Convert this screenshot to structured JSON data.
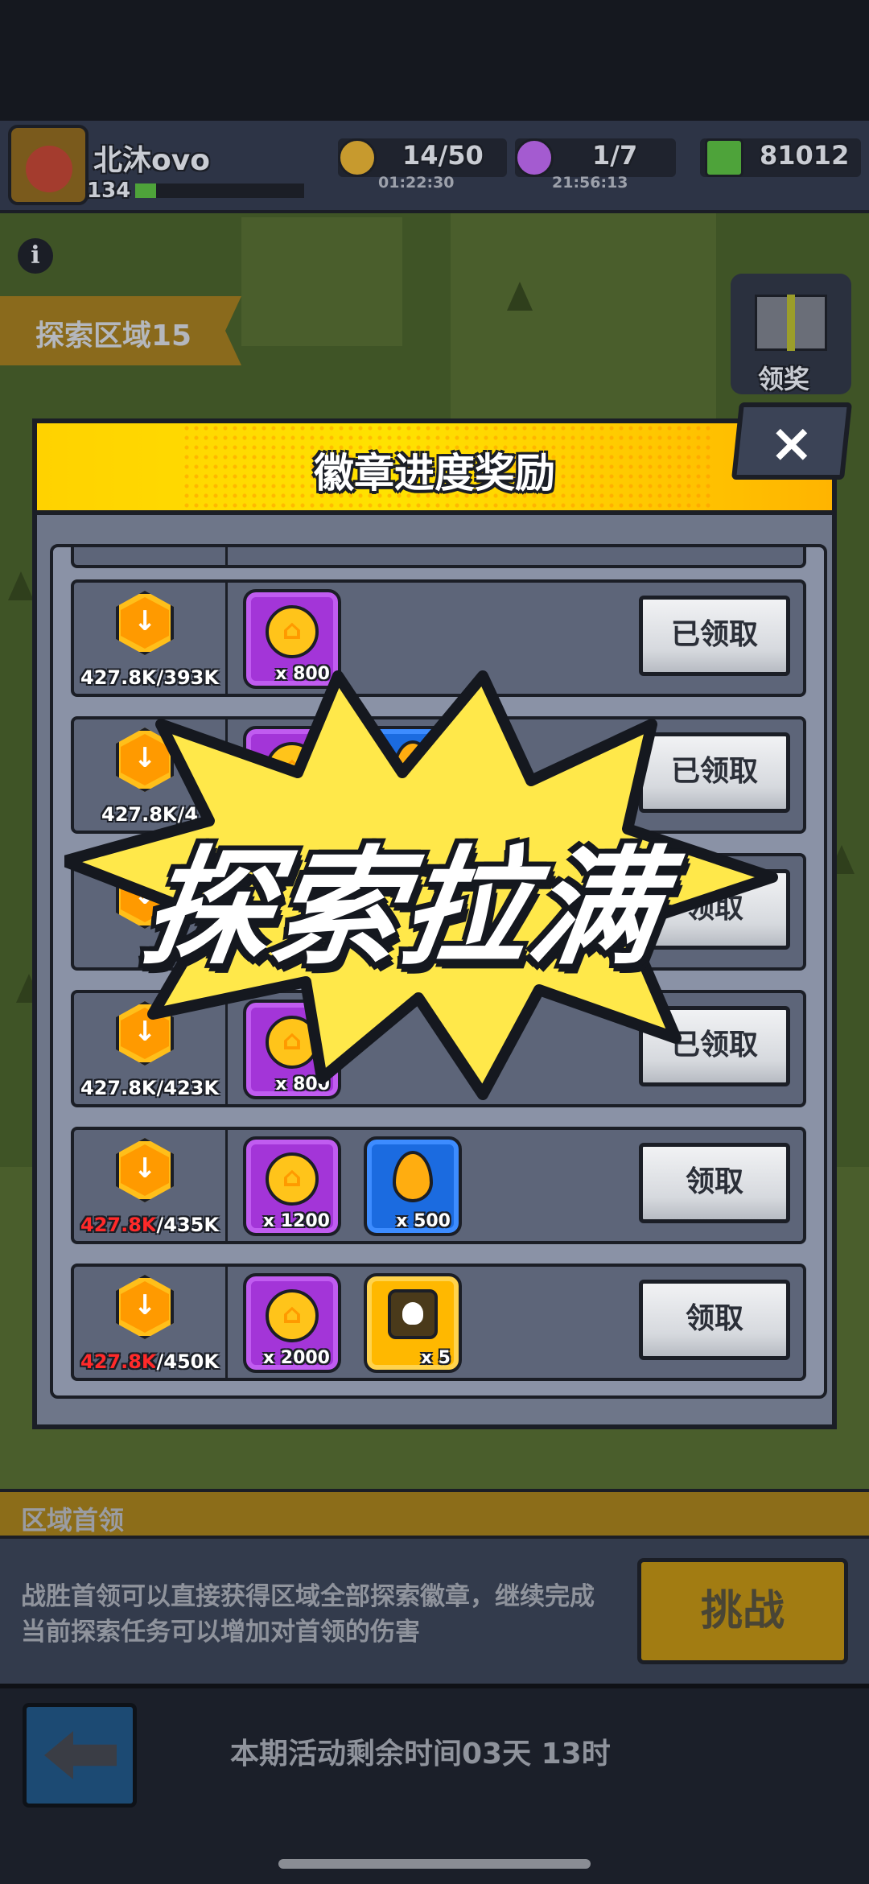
{
  "player": {
    "name": "北沐ovo",
    "level": "134"
  },
  "resources": [
    {
      "name": "energy",
      "value": "14/50",
      "timer": "01:22:30",
      "color": "#c79a2e"
    },
    {
      "name": "potion",
      "value": "1/7",
      "timer": "21:56:13",
      "color": "#a45bd0"
    },
    {
      "name": "gems",
      "value": "81012",
      "color": "#4ea33a"
    }
  ],
  "area": {
    "label": "探索区域15"
  },
  "gift": {
    "label": "领奖"
  },
  "modal": {
    "title": "徽章进度奖励",
    "close_icon": "×",
    "rows": [
      {
        "current": "427.8K",
        "target": "/393K",
        "reached": true,
        "rewards": [
          {
            "icon": "coin",
            "qty": "x 800"
          }
        ],
        "button": "已领取"
      },
      {
        "current": "427.8K",
        "target": "/4",
        "reached": true,
        "rewards": [
          {
            "icon": "coin",
            "qty": ""
          },
          {
            "icon": "drop",
            "qty": ""
          }
        ],
        "button": "已领取"
      },
      {
        "current": "",
        "target": "",
        "reached": true,
        "rewards": [],
        "button": "领取"
      },
      {
        "current": "427.8K",
        "target": "/423K",
        "reached": true,
        "rewards": [
          {
            "icon": "coin",
            "qty": "x 800"
          }
        ],
        "button": "已领取"
      },
      {
        "current": "427.8K",
        "target": "/435K",
        "reached": false,
        "rewards": [
          {
            "icon": "coin",
            "qty": "x 1200"
          },
          {
            "icon": "drop",
            "qty": "x 500"
          }
        ],
        "button": "领取"
      },
      {
        "current": "427.8K",
        "target": "/450K",
        "reached": false,
        "rewards": [
          {
            "icon": "coin",
            "qty": "x 2000"
          },
          {
            "icon": "skull",
            "qty": "x 5"
          }
        ],
        "button": "领取"
      }
    ]
  },
  "overlay_text": "探索拉满",
  "first_leader": {
    "title": "区域首领",
    "description": "战胜首领可以直接获得区域全部探索徽章，继续完成当前探索任务可以增加对首领的伤害",
    "button": "挑战"
  },
  "event_time": "本期活动剩余时间03天 13时",
  "colors": {
    "accent": "#ffd200",
    "badge": "#ffbf1a",
    "short_progress": "#ff2a2a"
  }
}
